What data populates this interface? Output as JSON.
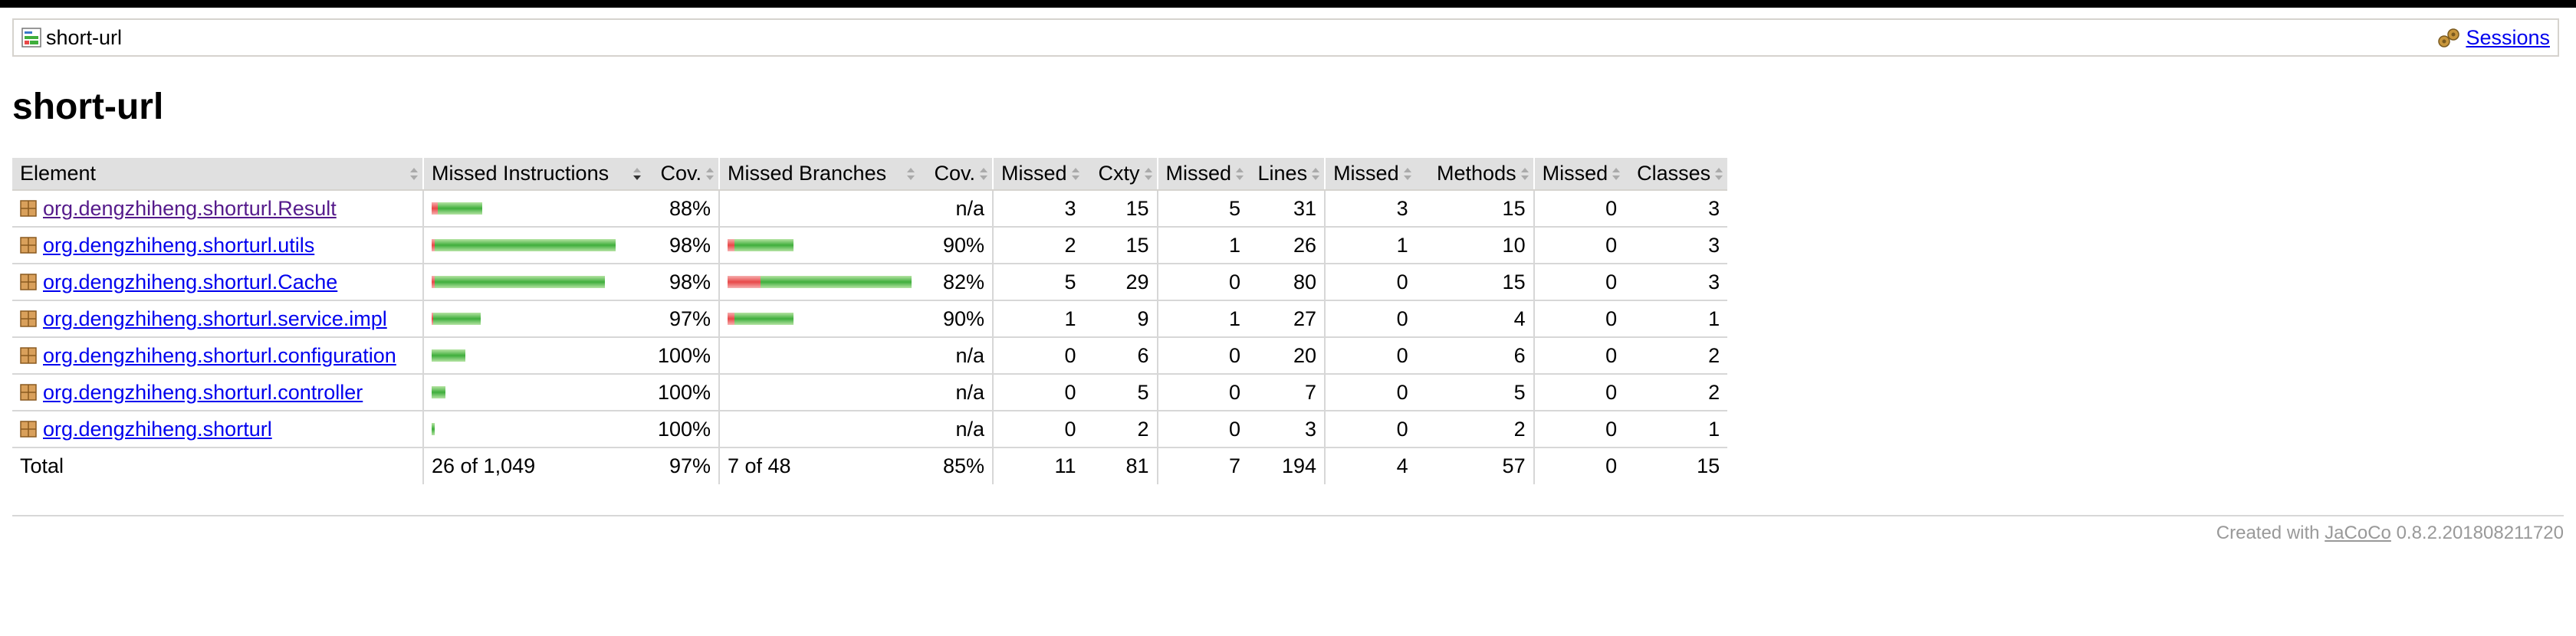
{
  "breadcrumb": {
    "label": "short-url",
    "sessions_label": "Sessions"
  },
  "page": {
    "title": "short-url"
  },
  "table": {
    "headers": {
      "element": "Element",
      "missed_instructions": "Missed Instructions",
      "instr_cov": "Cov.",
      "missed_branches": "Missed Branches",
      "branch_cov": "Cov.",
      "cxty_missed": "Missed",
      "cxty": "Cxty",
      "lines_missed": "Missed",
      "lines": "Lines",
      "methods_missed": "Missed",
      "methods": "Methods",
      "classes_missed": "Missed",
      "classes": "Classes"
    },
    "rows": [
      {
        "name": "org.dengzhiheng.shorturl.Result",
        "visited": true,
        "instr_missed": 8,
        "instr_covered": 58,
        "instr_cov": "88%",
        "br_missed": 0,
        "br_covered": 0,
        "br_cov": "n/a",
        "cxty_missed": "3",
        "cxty": "15",
        "lines_missed": "5",
        "lines": "31",
        "methods_missed": "3",
        "methods": "15",
        "classes_missed": "0",
        "classes": "3"
      },
      {
        "name": "org.dengzhiheng.shorturl.utils",
        "visited": false,
        "instr_missed": 4,
        "instr_covered": 236,
        "instr_cov": "98%",
        "br_missed": 2,
        "br_covered": 18,
        "br_cov": "90%",
        "cxty_missed": "2",
        "cxty": "15",
        "lines_missed": "1",
        "lines": "26",
        "methods_missed": "1",
        "methods": "10",
        "classes_missed": "0",
        "classes": "3"
      },
      {
        "name": "org.dengzhiheng.shorturl.Cache",
        "visited": false,
        "instr_missed": 4,
        "instr_covered": 222,
        "instr_cov": "98%",
        "br_missed": 10,
        "br_covered": 46,
        "br_cov": "82%",
        "cxty_missed": "5",
        "cxty": "29",
        "lines_missed": "0",
        "lines": "80",
        "methods_missed": "0",
        "methods": "15",
        "classes_missed": "0",
        "classes": "3"
      },
      {
        "name": "org.dengzhiheng.shorturl.service.impl",
        "visited": false,
        "instr_missed": 2,
        "instr_covered": 62,
        "instr_cov": "97%",
        "br_missed": 2,
        "br_covered": 18,
        "br_cov": "90%",
        "cxty_missed": "1",
        "cxty": "9",
        "lines_missed": "1",
        "lines": "27",
        "methods_missed": "0",
        "methods": "4",
        "classes_missed": "0",
        "classes": "1"
      },
      {
        "name": "org.dengzhiheng.shorturl.configuration",
        "visited": false,
        "instr_missed": 0,
        "instr_covered": 44,
        "instr_cov": "100%",
        "br_missed": 0,
        "br_covered": 0,
        "br_cov": "n/a",
        "cxty_missed": "0",
        "cxty": "6",
        "lines_missed": "0",
        "lines": "20",
        "methods_missed": "0",
        "methods": "6",
        "classes_missed": "0",
        "classes": "2"
      },
      {
        "name": "org.dengzhiheng.shorturl.controller",
        "visited": false,
        "instr_missed": 0,
        "instr_covered": 18,
        "instr_cov": "100%",
        "br_missed": 0,
        "br_covered": 0,
        "br_cov": "n/a",
        "cxty_missed": "0",
        "cxty": "5",
        "lines_missed": "0",
        "lines": "7",
        "methods_missed": "0",
        "methods": "5",
        "classes_missed": "0",
        "classes": "2"
      },
      {
        "name": "org.dengzhiheng.shorturl",
        "visited": false,
        "instr_missed": 0,
        "instr_covered": 4,
        "instr_cov": "100%",
        "br_missed": 0,
        "br_covered": 0,
        "br_cov": "n/a",
        "cxty_missed": "0",
        "cxty": "2",
        "lines_missed": "0",
        "lines": "3",
        "methods_missed": "0",
        "methods": "2",
        "classes_missed": "0",
        "classes": "1"
      }
    ],
    "total": {
      "label": "Total",
      "instructions": "26 of 1,049",
      "instr_cov": "97%",
      "branches": "7 of 48",
      "br_cov": "85%",
      "cxty_missed": "11",
      "cxty": "81",
      "lines_missed": "7",
      "lines": "194",
      "methods_missed": "4",
      "methods": "57",
      "classes_missed": "0",
      "classes": "15"
    }
  },
  "footer": {
    "prefix": "Created with",
    "link": "JaCoCo",
    "version": "0.8.2.201808211720"
  },
  "colors": {
    "link": "#0000ee",
    "visited_link": "#551a8b",
    "bar_green": "#3fae3c",
    "bar_red": "#e84848",
    "header_bg": "#e0e0e0"
  }
}
